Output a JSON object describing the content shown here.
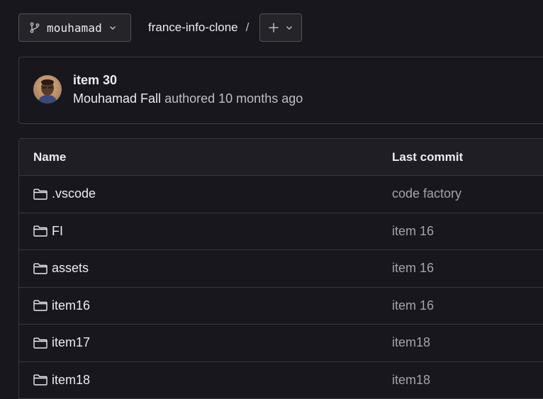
{
  "toolbar": {
    "branch": "mouhamad",
    "repo": "france-info-clone",
    "separator": "/",
    "branch_icon": "git-branch-icon",
    "add_icon": "plus-icon"
  },
  "last_commit": {
    "title": "item 30",
    "author": "Mouhamad Fall",
    "verb": "authored",
    "time": "10 months ago"
  },
  "table": {
    "headers": {
      "name": "Name",
      "last_commit": "Last commit"
    },
    "rows": [
      {
        "name": ".vscode",
        "commit": "code factory"
      },
      {
        "name": "FI",
        "commit": "item 16"
      },
      {
        "name": "assets",
        "commit": "item 16"
      },
      {
        "name": "item16",
        "commit": "item 16"
      },
      {
        "name": "item17",
        "commit": "item18"
      },
      {
        "name": "item18",
        "commit": "item18"
      }
    ]
  }
}
